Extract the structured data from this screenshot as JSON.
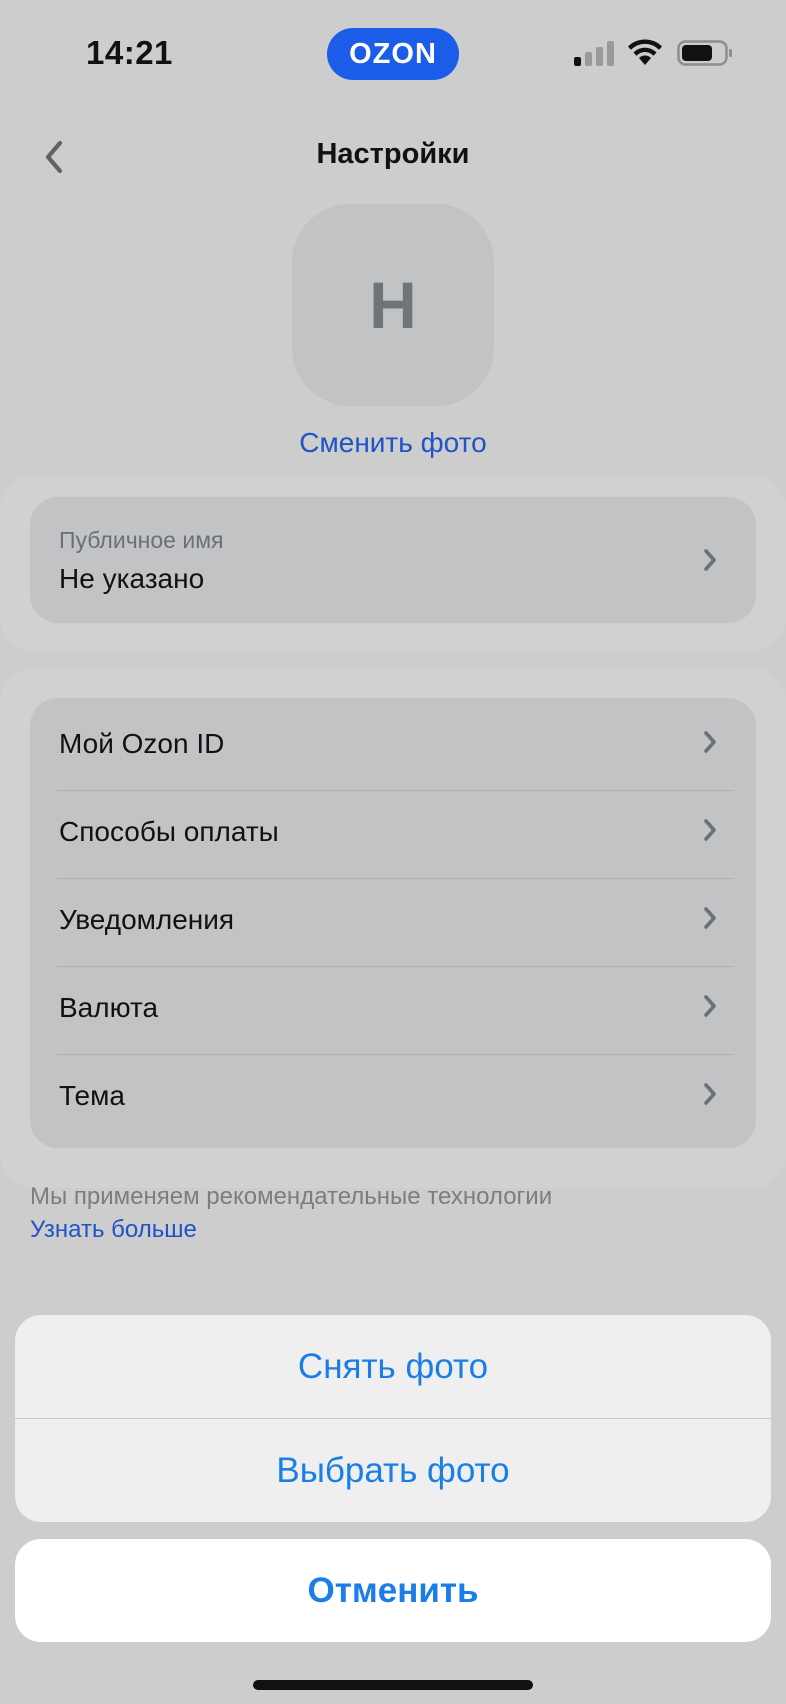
{
  "status_bar": {
    "time": "14:21",
    "brand": "OZON",
    "signal_icon": "cellular-signal-icon",
    "wifi_icon": "wifi-icon",
    "battery_icon": "battery-icon"
  },
  "header": {
    "back_icon": "chevron-left-icon",
    "title": "Настройки"
  },
  "profile": {
    "avatar_initial": "Н",
    "change_photo_label": "Сменить фото",
    "public_name_label": "Публичное имя",
    "public_name_value": "Не указано"
  },
  "menu": {
    "items": [
      {
        "label": "Мой Ozon ID"
      },
      {
        "label": "Способы оплаты"
      },
      {
        "label": "Уведомления"
      },
      {
        "label": "Валюта"
      },
      {
        "label": "Тема"
      }
    ]
  },
  "footer": {
    "info_text": "Мы применяем рекомендательные технологии",
    "learn_more": "Узнать больше"
  },
  "action_sheet": {
    "take_photo": "Снять фото",
    "choose_photo": "Выбрать фото",
    "cancel": "Отменить"
  },
  "colors": {
    "accent": "#1b5ce8",
    "sheet_text": "#1a7ee6",
    "link": "#1e54c8"
  }
}
